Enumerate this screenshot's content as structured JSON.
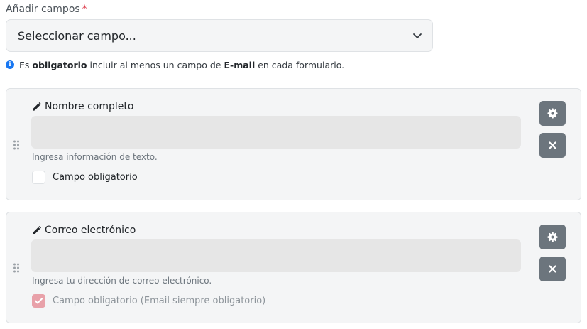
{
  "add_fields": {
    "label": "Añadir campos",
    "required_marker": "*",
    "select_value": "Seleccionar campo..."
  },
  "notice": {
    "part1": "Es",
    "bold1": "obligatorio",
    "part2": "incluir al menos un campo de",
    "bold2": "E-mail",
    "part3": "en cada formulario."
  },
  "fields": [
    {
      "label": "Nombre completo",
      "help": "Ingresa información de texto.",
      "required_label": "Campo obligatorio",
      "required_checked": false
    },
    {
      "label": "Correo electrónico",
      "help": "Ingresa tu dirección de correo electrónico.",
      "required_label": "Campo obligatorio (Email siempre obligatorio)",
      "required_checked": true
    }
  ],
  "colors": {
    "button": "#6c757d",
    "card_bg": "#f4f5f6",
    "info": "#1877f2",
    "required": "#dc3545",
    "checked_disabled": "#e8a1a9"
  },
  "icons": {
    "select": "chevron-down-icon",
    "notice": "info-icon",
    "label": "pencil-icon",
    "grip": "drag-handle-icon",
    "settings": "gear-icon",
    "remove": "close-icon",
    "check": "checkmark-icon"
  }
}
